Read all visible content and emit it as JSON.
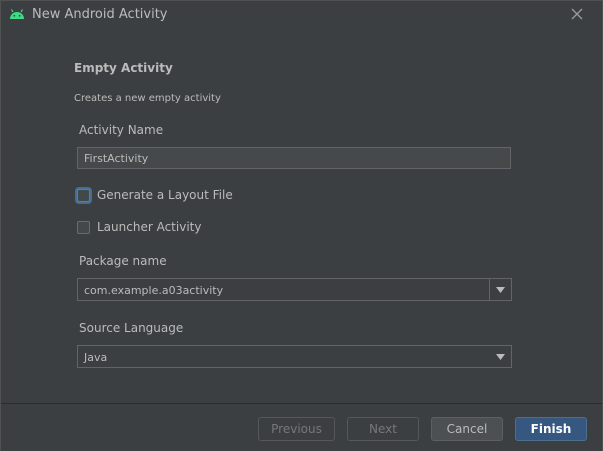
{
  "window": {
    "title": "New Android Activity"
  },
  "template": {
    "heading": "Empty Activity",
    "description": "Creates a new empty activity"
  },
  "form": {
    "activity_name_label": "Activity Name",
    "activity_name_value": "FirstActivity",
    "generate_layout_label": "Generate a Layout File",
    "generate_layout_checked": false,
    "launcher_activity_label": "Launcher Activity",
    "launcher_activity_checked": false,
    "package_name_label": "Package name",
    "package_name_value": "com.example.a03activity",
    "source_language_label": "Source Language",
    "source_language_value": "Java"
  },
  "buttons": {
    "previous": "Previous",
    "next": "Next",
    "cancel": "Cancel",
    "finish": "Finish"
  },
  "icons": {
    "app_icon": "android-icon",
    "close": "close-icon",
    "dropdown": "chevron-down-icon"
  },
  "colors": {
    "android_green": "#3ddc84",
    "primary_button": "#365880",
    "focus_ring": "#3d87c9"
  }
}
